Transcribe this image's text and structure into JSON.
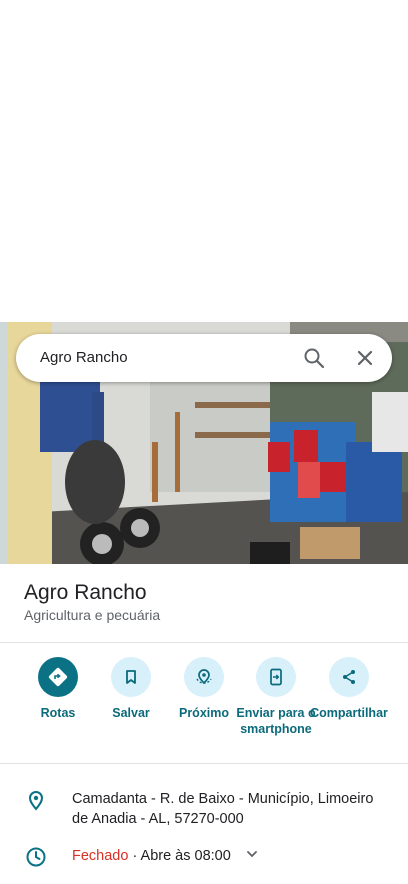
{
  "search": {
    "query": "Agro Rancho"
  },
  "place": {
    "name": "Agro Rancho",
    "category": "Agricultura e pecuária"
  },
  "actions": [
    {
      "label": "Rotas",
      "icon": "directions-icon"
    },
    {
      "label": "Salvar",
      "icon": "bookmark-icon"
    },
    {
      "label": "Próximo",
      "icon": "nearby-icon"
    },
    {
      "label": "Enviar para o smartphone",
      "icon": "send-to-phone-icon"
    },
    {
      "label": "Compartilhar",
      "icon": "share-icon"
    }
  ],
  "info": {
    "address": "Camadanta - R. de Baixo - Município, Limoeiro de Anadia - AL, 57270-000",
    "hours_status": "Fechado",
    "hours_detail": " · Abre às 08:00"
  },
  "colors": {
    "accent": "#0b7285",
    "closed": "#d93025",
    "action_bg": "#d7f0fa"
  }
}
